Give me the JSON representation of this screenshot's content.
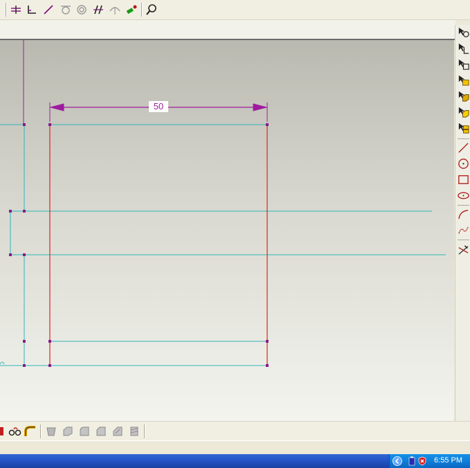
{
  "toolbar_top": {
    "icons": [
      "constraint-icon",
      "angle-icon",
      "line-icon",
      "tangent-icon",
      "concentric-icon",
      "parallel-icon",
      "symmetry-icon",
      "auto-constraint-icon",
      "zoom-icon"
    ]
  },
  "sketch": {
    "dimension_value": "50",
    "colors": {
      "construction": "#2fb6b6",
      "profile": "#e02020",
      "dimension": "#a01aa0",
      "point": "#8b1a8b"
    }
  },
  "right_toolbar": {
    "icons": [
      "select-icon",
      "point-select-icon",
      "edge-select-icon",
      "face-select-icon",
      "body-select-icon",
      "solid-select-icon",
      "multi-select-icon",
      "line-tool-icon",
      "circle-tool-icon",
      "rectangle-tool-icon",
      "ellipse-tool-icon",
      "arc-tool-icon",
      "spline-tool-icon",
      "trim-tool-icon"
    ]
  },
  "taskbar": {
    "clock": "6:55 PM"
  }
}
